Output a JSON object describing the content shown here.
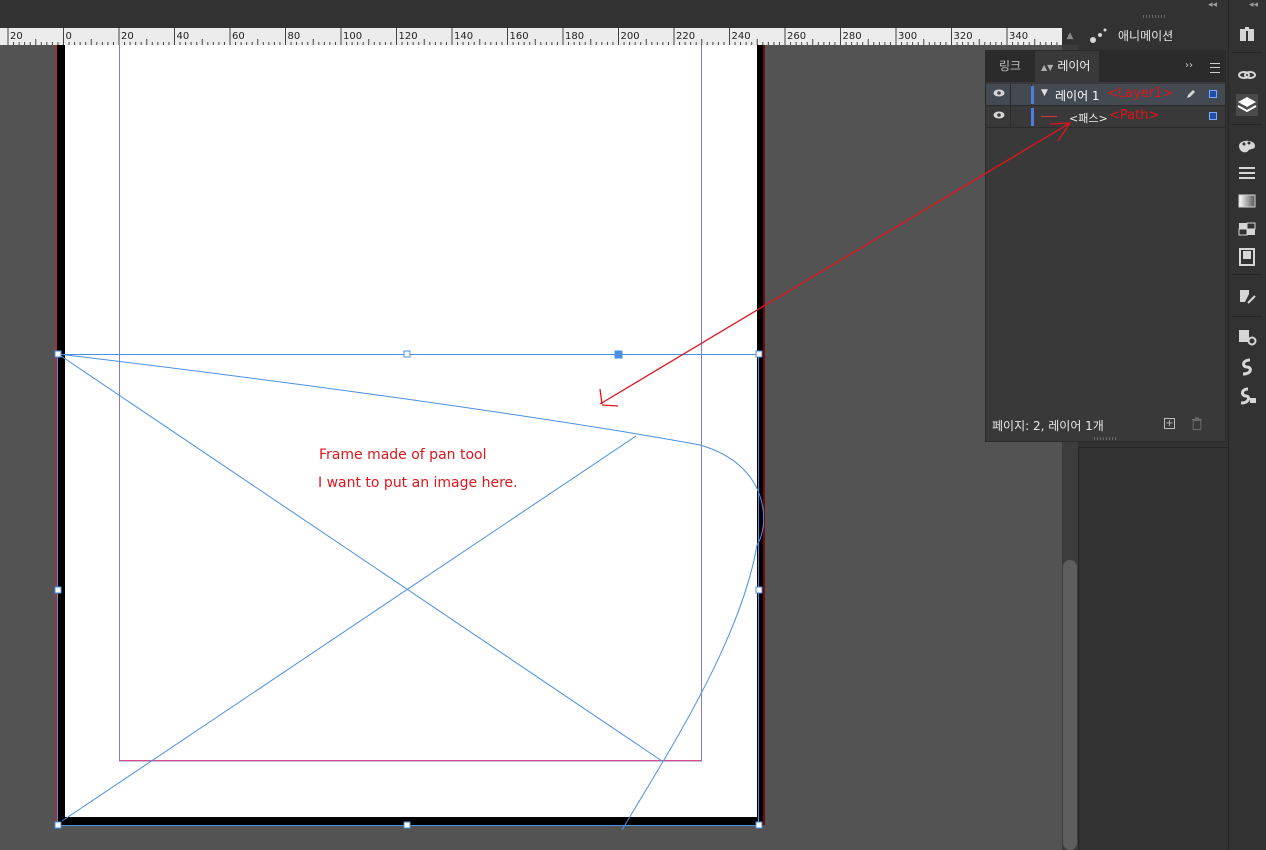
{
  "ruler": {
    "labels": [
      "20",
      "0",
      "20",
      "40",
      "60",
      "80",
      "100",
      "120",
      "140",
      "160",
      "180",
      "200",
      "220",
      "240",
      "260",
      "280",
      "300",
      "320",
      "340"
    ]
  },
  "animation_panel": {
    "title": "애니메이션"
  },
  "layers_panel": {
    "tabs": [
      {
        "label": "링크",
        "active": false
      },
      {
        "label": "레이어",
        "active": true
      }
    ],
    "rows": [
      {
        "name": "레이어 1",
        "annotation": "<Layer1>"
      },
      {
        "name": "<패스>",
        "annotation": "<Path>"
      }
    ],
    "footer": "페이지: 2, 레이어 1개"
  },
  "canvas_annotations": {
    "line1": "Frame made of pan tool",
    "line2": "I want to put an image here."
  },
  "colors": {
    "annotation_red": "#e0151c",
    "selection_blue": "#4a90e2",
    "margin_purple": "#8b79c8",
    "bleed_red": "#e0151c",
    "layer_color": "#4f7fdc"
  },
  "tool_icons": [
    "cc-libraries-icon",
    "links-icon",
    "layers-icon",
    "swatches-icon",
    "stroke-icon",
    "gradient-icon",
    "effects-icon",
    "pages-icon",
    "paragraph-styles-icon",
    "cc-tools-icon",
    "character-styles-icon",
    "object-styles-icon"
  ]
}
